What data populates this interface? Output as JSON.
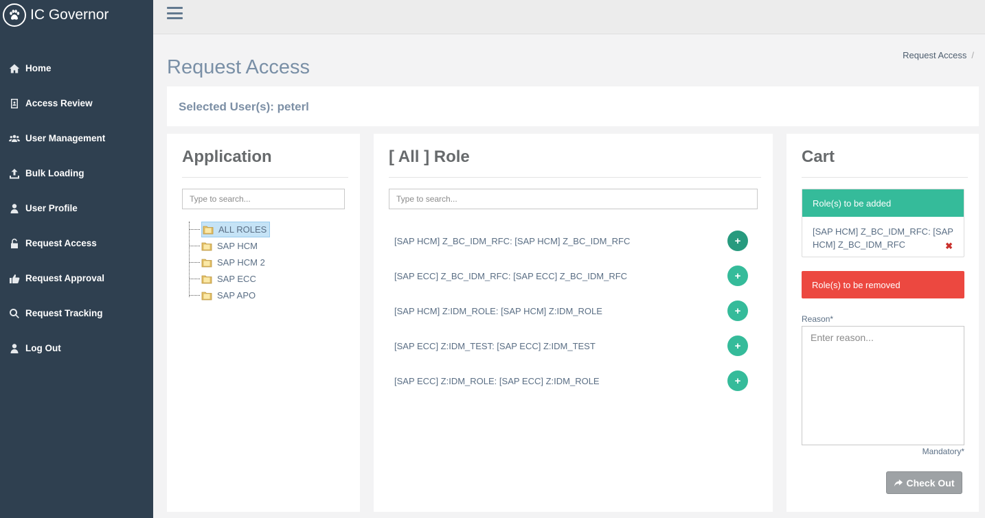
{
  "app": {
    "title": "IC Governor"
  },
  "sidebar": {
    "items": [
      {
        "label": "Home",
        "icon": "home-icon"
      },
      {
        "label": "Access Review",
        "icon": "id-badge-icon"
      },
      {
        "label": "User Management",
        "icon": "users-icon"
      },
      {
        "label": "Bulk Loading",
        "icon": "upload-icon"
      },
      {
        "label": "User Profile",
        "icon": "user-icon"
      },
      {
        "label": "Request Access",
        "icon": "unlock-icon"
      },
      {
        "label": "Request Approval",
        "icon": "thumbs-up-icon"
      },
      {
        "label": "Request Tracking",
        "icon": "search-icon"
      },
      {
        "label": "Log Out",
        "icon": "user-icon"
      }
    ]
  },
  "page": {
    "title": "Request Access",
    "breadcrumb": "Request Access",
    "breadcrumb_sep": "/",
    "selected_users": "Selected User(s): peterl"
  },
  "application": {
    "title": "Application",
    "search_placeholder": "Type to search...",
    "tree": [
      "ALL ROLES",
      "SAP HCM",
      "SAP HCM 2",
      "SAP ECC",
      "SAP APO"
    ],
    "selected": "ALL ROLES"
  },
  "roles": {
    "title": "[ All ] Role",
    "search_placeholder": "Type to search...",
    "items": [
      "[SAP HCM] Z_BC_IDM_RFC: [SAP HCM] Z_BC_IDM_RFC",
      "[SAP ECC] Z_BC_IDM_RFC: [SAP ECC] Z_BC_IDM_RFC",
      "[SAP HCM] Z:IDM_ROLE: [SAP HCM] Z:IDM_ROLE",
      "[SAP ECC] Z:IDM_TEST: [SAP ECC] Z:IDM_TEST",
      "[SAP ECC] Z:IDM_ROLE: [SAP ECC] Z:IDM_ROLE"
    ],
    "add_glyph": "+"
  },
  "cart": {
    "title": "Cart",
    "added_header": "Role(s) to be added",
    "added_items": [
      "[SAP HCM] Z_BC_IDM_RFC: [SAP HCM] Z_BC_IDM_RFC"
    ],
    "remove_glyph": "✖",
    "removed_header": "Role(s) to be removed",
    "reason_label": "Reason*",
    "reason_placeholder": "Enter reason...",
    "mandatory": "Mandatory*",
    "checkout_label": "Check Out"
  },
  "colors": {
    "sidebar_bg": "#2f4050",
    "accent_green": "#35bb9a",
    "remove_red": "#ec4840",
    "title_blue": "#798fa6"
  }
}
